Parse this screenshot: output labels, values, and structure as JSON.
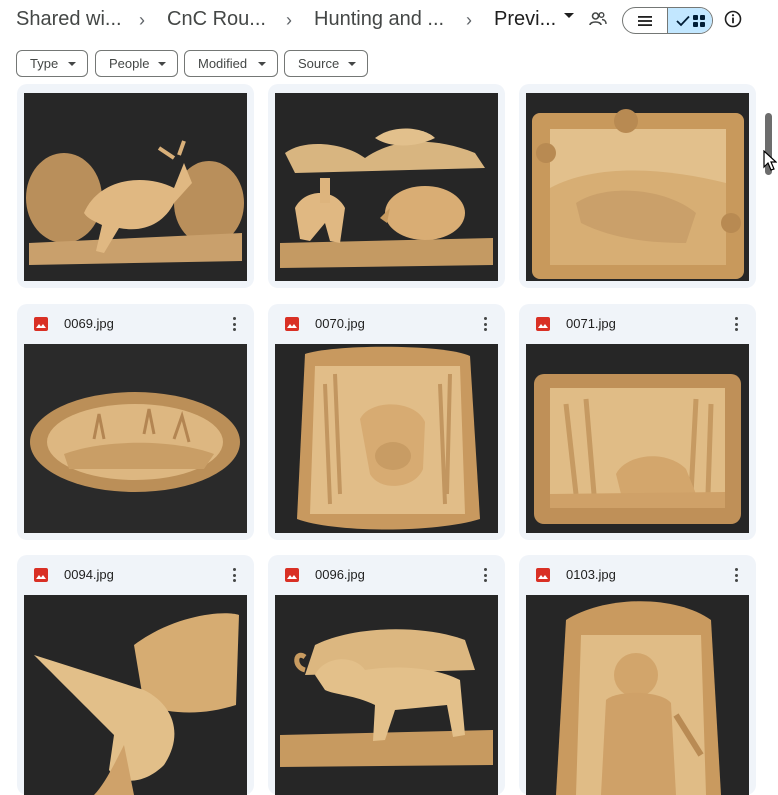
{
  "breadcrumb": {
    "items": [
      "Shared wi...",
      "CnC Rou...",
      "Hunting and ...",
      "Previ..."
    ],
    "separator": "›"
  },
  "toolbar": {
    "list_view_icon": "list-icon",
    "grid_view_icon": "grid-icon",
    "check_icon": "check-icon",
    "people_icon": "people-icon",
    "info_icon": "info-icon"
  },
  "filters": [
    "Type",
    "People",
    "Modified",
    "Source"
  ],
  "files": [
    {
      "name": "",
      "subject": "deer leaping in forest"
    },
    {
      "name": "",
      "subject": "rider hunting bison"
    },
    {
      "name": "",
      "subject": "fish in ornate frame"
    },
    {
      "name": "0069.jpg",
      "subject": "oval lake scene"
    },
    {
      "name": "0070.jpg",
      "subject": "dog in reeds"
    },
    {
      "name": "0071.jpg",
      "subject": "fox in pine forest"
    },
    {
      "name": "0094.jpg",
      "subject": "sailfish"
    },
    {
      "name": "0096.jpg",
      "subject": "ram in meadow"
    },
    {
      "name": "0103.jpg",
      "subject": "hunter with ducks"
    }
  ],
  "colors": {
    "accent_toggle": "#c2e7ff",
    "card_bg": "#f0f4f9",
    "image_icon": "#d93025",
    "wood": "#d9b07a",
    "wood_dark": "#a8804e",
    "thumb_bg": "#262626"
  }
}
